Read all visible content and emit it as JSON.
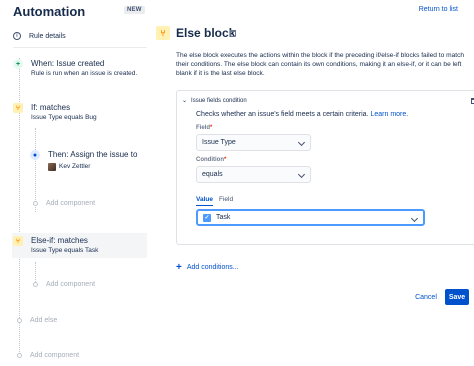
{
  "header": {
    "title": "Automation",
    "badge": "NEW",
    "return_link": "Return to list"
  },
  "sidebar": {
    "rule_details": "Rule details",
    "trigger": {
      "title": "When: Issue created",
      "subtitle": "Rule is run when an issue is created."
    },
    "if_condition": {
      "title": "If: matches",
      "subtitle": "Issue Type equals Bug"
    },
    "action": {
      "title": "Then: Assign the issue to",
      "assignee": "Kev Zettler"
    },
    "add_component_1": "Add component",
    "else_if": {
      "title": "Else-if: matches",
      "subtitle": "Issue Type equals Task"
    },
    "add_component_2": "Add component",
    "add_else": "Add else",
    "add_component_3": "Add component"
  },
  "main": {
    "title": "Else block",
    "description": "The else block executes the actions within the block if the preceding if/else-if blocks failed to match their conditions. The else block can contain its own conditions, making it an else-if, or it can be left blank if it is the last else block.",
    "panel": {
      "heading": "Issue fields condition",
      "text": "Checks whether an issue's field meets a certain criteria.",
      "learn_more": "Learn more.",
      "field_label": "Field",
      "field_value": "Issue Type",
      "condition_label": "Condition",
      "condition_value": "equals",
      "required_mark": "*",
      "tabs": [
        "Value",
        "Field"
      ],
      "value_selected": "Task"
    },
    "add_conditions": "Add conditions...",
    "cancel": "Cancel",
    "save": "Save"
  },
  "colors": {
    "primary": "#0052cc",
    "condition_icon_bg": "#fff0b3",
    "condition_icon_fg": "#ff8b00",
    "trigger_icon": "#00875a"
  }
}
